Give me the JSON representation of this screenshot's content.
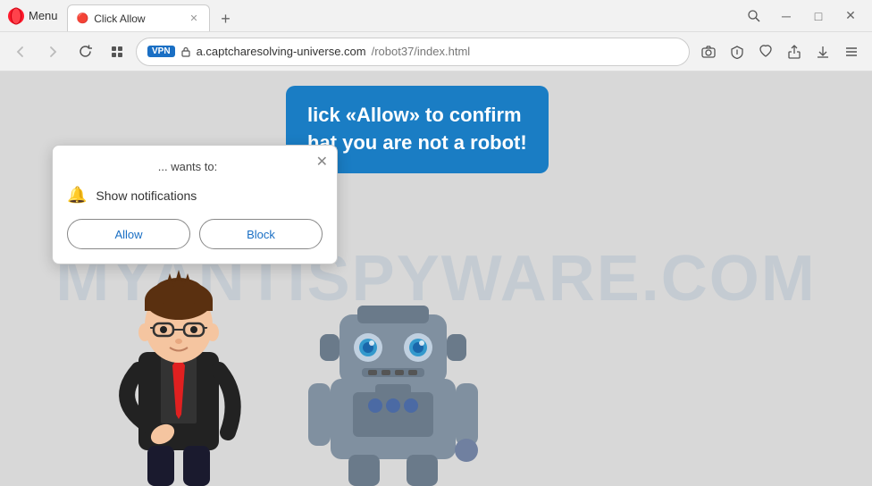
{
  "browser": {
    "menu_label": "Menu",
    "tab": {
      "favicon": "🔴",
      "title": "Click Allow",
      "close": "✕"
    },
    "new_tab_icon": "+",
    "window_controls": {
      "search": "🔍",
      "minimize": "─",
      "maximize": "□",
      "close": "✕"
    }
  },
  "navbar": {
    "back": "‹",
    "forward": "›",
    "reload": "↻",
    "grid": "⊞",
    "vpn": "VPN",
    "lock": "🔒",
    "address_domain": "a.captcharesolving-universe.com",
    "address_path": "/robot37/index.html",
    "icons": {
      "camera": "📷",
      "shield": "🛡",
      "heart": "♡",
      "share": "⬆",
      "download": "⬇",
      "menu": "≡"
    }
  },
  "popup": {
    "header": "... wants to:",
    "close_icon": "✕",
    "notification_icon": "🔔",
    "notification_text": "Show notifications",
    "allow_label": "Allow",
    "block_label": "Block"
  },
  "page": {
    "watermark": "MYANTISPYWARE.COM",
    "blue_box_line1": "lick «Allow» to confirm",
    "blue_box_line2": "hat you are not a robot!"
  }
}
